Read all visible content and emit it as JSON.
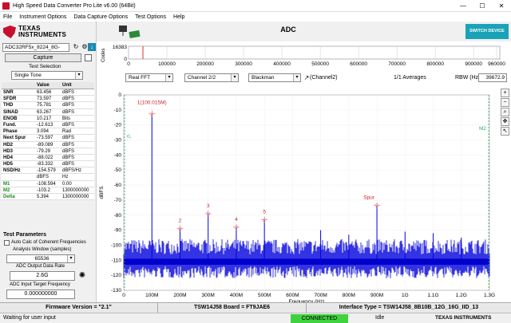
{
  "window": {
    "title": "High Speed Data Converter Pro Lite v6.00 (64Bit)",
    "controls": [
      "—",
      "☐",
      "✕"
    ]
  },
  "menu": [
    "File",
    "Instrument Options",
    "Data Capture Options",
    "Test Options",
    "Help"
  ],
  "logo": {
    "line1": "TEXAS",
    "line2": "INSTRUMENTS"
  },
  "left": {
    "device": "ADC32RF5x_8224_8G-",
    "capture_label": "Capture",
    "test_selection_label": "Test Selection",
    "test_selection_value": "Single Tone",
    "table": {
      "headers": [
        "",
        "Value",
        "Unit"
      ],
      "rows": [
        [
          "SNR",
          "63.456",
          "dBFS"
        ],
        [
          "SFDR",
          "73.597",
          "dBFS"
        ],
        [
          "THD",
          "75.781",
          "dBFS"
        ],
        [
          "SINAD",
          "63.267",
          "dBFS"
        ],
        [
          "ENOB",
          "10.217",
          "Bits"
        ],
        [
          "Fund.",
          "-12.613",
          "dBFS"
        ],
        [
          "Phase",
          "3.094",
          "Rad"
        ],
        [
          "Next Spur",
          "-73.597",
          "dBFS"
        ],
        [
          "HD2",
          "-89.089",
          "dBFS"
        ],
        [
          "HD3",
          "-79.29",
          "dBFS"
        ],
        [
          "HD4",
          "-88.022",
          "dBFS"
        ],
        [
          "HD5",
          "-83.332",
          "dBFS"
        ],
        [
          "NSD/Hz",
          "-154.579",
          "dBFS/Hz"
        ],
        [
          "",
          "dBFS",
          "Hz"
        ],
        [
          "M1",
          "-108.594",
          "0.00"
        ],
        [
          "M2",
          "-103.2",
          "1300000000"
        ],
        [
          "Delta",
          "5.394",
          "1300000000"
        ]
      ]
    },
    "test_params_title": "Test Parameters",
    "coherent_label": "Auto Calc of Coherent Frequencies",
    "analysis_window_label": "Analysis Window (samples)",
    "analysis_window_value": "65536",
    "output_rate_label": "ADC Output Data Rate",
    "output_rate_value": "2.6G",
    "target_freq_label": "ADC Input Target Frequency",
    "target_freq_value": "0.000000000"
  },
  "main": {
    "title": "ADC",
    "switch_label": "SWITCH DEVICE",
    "codes_label": "Codes",
    "codes_max": "16383",
    "codes_min": "0",
    "codes_ticks": [
      "0",
      "100000",
      "200000",
      "300000",
      "400000",
      "500000",
      "600000",
      "700000",
      "800000",
      "900000",
      "960000"
    ],
    "dropdowns": {
      "fft": "Real FFT",
      "channel": "Channel 2/2",
      "window": "Blackman"
    },
    "channel_label": "(Channel2)",
    "averages": "1/1 Averages",
    "rbw_label": "RBW (Hz)",
    "rbw_value": "39672.9"
  },
  "status": {
    "firmware": "Firmware Version = \"2.1\"",
    "board": "TSW14J58 Board = FT9JAE6",
    "interface": "Interface Type = TSW14J58_8B10B_12G_16G_IID_13",
    "message": "Waiting for user input",
    "connection": "CONNECTED",
    "state": "Idle",
    "brand": "TEXAS INSTRUMENTS"
  },
  "chart_data": {
    "type": "line",
    "title": "",
    "xlabel": "Frequency (Hz)",
    "ylabel": "dBFS",
    "xlim": [
      0,
      1300
    ],
    "ylim": [
      -130,
      0
    ],
    "x_ticks": [
      "0",
      "100M",
      "200M",
      "300M",
      "400M",
      "500M",
      "600M",
      "700M",
      "800M",
      "900M",
      "1G",
      "1.1G",
      "1.2G",
      "1.3G"
    ],
    "y_ticks": [
      "0",
      "-10",
      "-20",
      "-30",
      "-40",
      "-50",
      "-60",
      "-70",
      "-80",
      "-90",
      "-100",
      "-110",
      "-120",
      "-130"
    ],
    "grid": true,
    "noise_floor": -110,
    "markers": [
      {
        "label": "1(100.015M)",
        "x": 100,
        "y": -12.6
      },
      {
        "label": "2",
        "x": 200,
        "y": -89
      },
      {
        "label": "3",
        "x": 300,
        "y": -79
      },
      {
        "label": "4",
        "x": 400,
        "y": -88
      },
      {
        "label": "5",
        "x": 500,
        "y": -83
      },
      {
        "label": "Spur",
        "x": 900,
        "y": -73.6
      }
    ],
    "spurs": [
      {
        "x": 100,
        "y": -12.6
      },
      {
        "x": 200,
        "y": -89
      },
      {
        "x": 300,
        "y": -79
      },
      {
        "x": 400,
        "y": -88
      },
      {
        "x": 500,
        "y": -83
      },
      {
        "x": 700,
        "y": -90
      },
      {
        "x": 800,
        "y": -93
      },
      {
        "x": 900,
        "y": -73.6
      },
      {
        "x": 1000,
        "y": -91
      },
      {
        "x": 1100,
        "y": -92
      },
      {
        "x": 1200,
        "y": -95
      }
    ],
    "marker_lines": [
      {
        "label": "0,",
        "x": 0
      },
      {
        "label": "M2",
        "x": 1300
      }
    ]
  }
}
